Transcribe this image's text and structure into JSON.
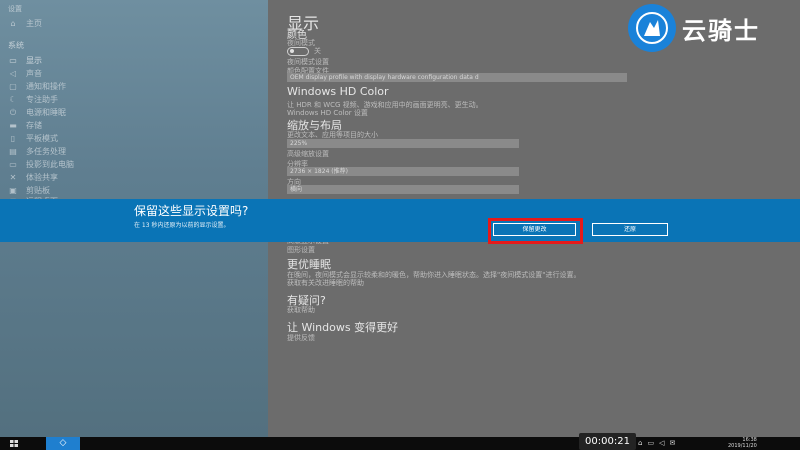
{
  "sidebar": {
    "title": "设置",
    "home": "主页",
    "section": "系统",
    "items": [
      {
        "icon": "display-icon",
        "label": "显示"
      },
      {
        "icon": "sound-icon",
        "label": "声音"
      },
      {
        "icon": "notifications-icon",
        "label": "通知和操作"
      },
      {
        "icon": "focus-icon",
        "label": "专注助手"
      },
      {
        "icon": "power-icon",
        "label": "电源和睡眠"
      },
      {
        "icon": "storage-icon",
        "label": "存储"
      },
      {
        "icon": "tablet-icon",
        "label": "平板模式"
      },
      {
        "icon": "multitask-icon",
        "label": "多任务处理"
      },
      {
        "icon": "project-icon",
        "label": "投影到此电脑"
      },
      {
        "icon": "shared-icon",
        "label": "体验共享"
      },
      {
        "icon": "clipboard-icon",
        "label": "剪贴板"
      },
      {
        "icon": "remote-icon",
        "label": "远程桌面"
      }
    ]
  },
  "main": {
    "page_title": "显示",
    "color_header": "颜色",
    "night_light_label": "夜间模式",
    "night_light_state": "关",
    "night_light_settings": "夜间模式设置",
    "color_profile_label": "颜色配置文件",
    "color_profile_value": "OEM display profile with display hardware configuration data d",
    "hd_color_header": "Windows HD Color",
    "hd_color_desc": "让 HDR 和 WCG 视频、游戏和应用中的画面更明亮、更生动。",
    "hd_color_link": "Windows HD Color 设置",
    "scale_header": "缩放与布局",
    "scale_label": "更改文本、应用等项目的大小",
    "scale_value": "225%",
    "advanced_scale": "高级缩放设置",
    "resolution_label": "分辨率",
    "resolution_value": "2736 × 1824 (推荐)",
    "orientation_label": "方向",
    "orientation_value": "横向",
    "advanced_display": "高级显示设置",
    "graphics_settings": "图形设置",
    "sleep_header": "更优睡眠",
    "sleep_desc": "在晚间，夜间模式会显示较柔和的暖色，帮助你进入睡眠状态。选择\"夜间模式设置\"进行设置。",
    "sleep_link": "获取有关改进睡眠的帮助",
    "help_header": "有疑问?",
    "help_link": "获取帮助",
    "improve_header": "让 Windows 变得更好",
    "feedback_link": "提供反馈"
  },
  "banner": {
    "title": "保留这些显示设置吗?",
    "countdown": "在 13 秒内还原为以前的显示设置。",
    "keep_button": "保留更改",
    "revert_button": "还原"
  },
  "taskbar": {
    "time": "16:38",
    "date": "2019/11/20"
  },
  "video": {
    "timestamp": "00:00:21"
  },
  "watermark": {
    "text": "云骑士"
  },
  "colors": {
    "banner_bg": "#0a74b6",
    "highlight": "#e61a1a",
    "logo_blue": "#1a82d9"
  }
}
